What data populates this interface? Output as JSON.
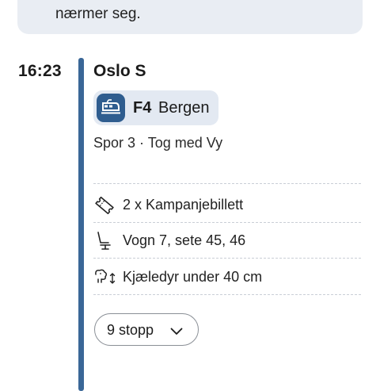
{
  "notice": {
    "text": "nærmer seg."
  },
  "leg": {
    "time": "16:23",
    "station": "Oslo S",
    "line": {
      "code": "F4",
      "destination": "Bergen",
      "icon": "train-icon"
    },
    "platform_info": "Spor 3 · Tog med Vy",
    "details": [
      {
        "icon": "ticket-icon",
        "text": "2 x Kampanjebillett"
      },
      {
        "icon": "seat-icon",
        "text": "Vogn 7, sete 45, 46"
      },
      {
        "icon": "pet-icon",
        "text": "Kjæledyr under 40 cm"
      }
    ],
    "stops_button": {
      "label": "9 stopp",
      "icon": "chevron-down-icon"
    }
  },
  "colors": {
    "accent": "#3a6797",
    "badge_bg": "#e3e9f2",
    "notice_bg": "#e9edf3"
  }
}
